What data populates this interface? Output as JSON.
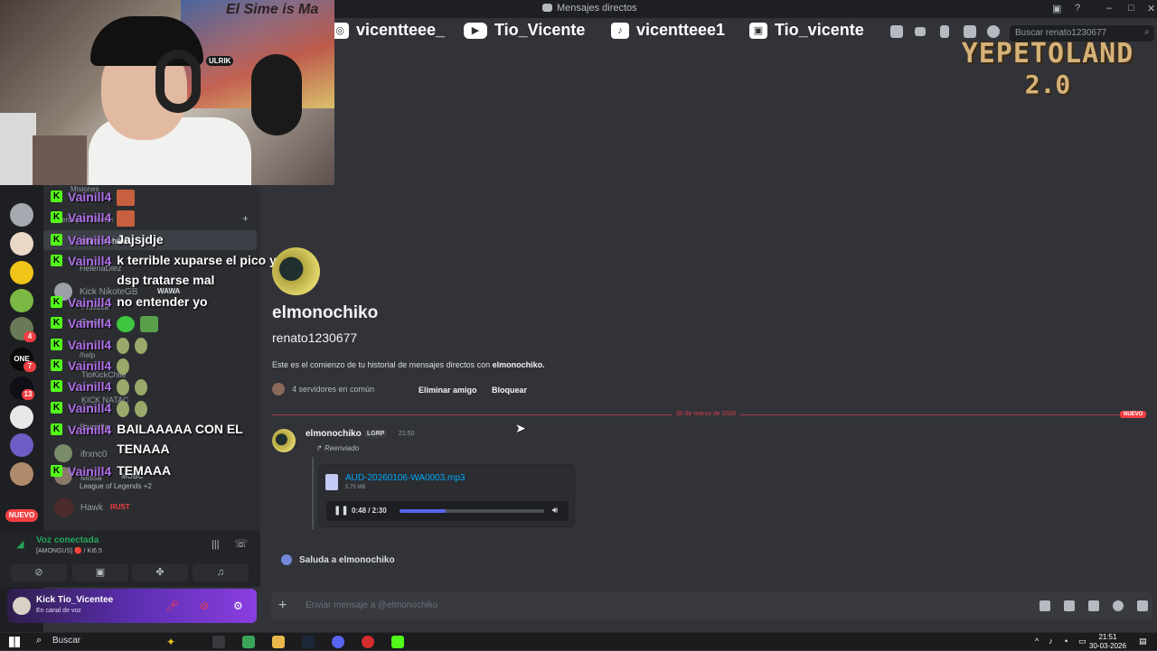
{
  "window": {
    "title": "Mensajes directos"
  },
  "socials": [
    {
      "icon": "instagram-icon",
      "glyph": "◎",
      "handle": "vicentteee_"
    },
    {
      "icon": "youtube-icon",
      "glyph": "▶",
      "handle": "Tio_Vicente"
    },
    {
      "icon": "tiktok-icon",
      "glyph": "♪",
      "handle": "vicentteee1"
    },
    {
      "icon": "twitch-icon",
      "glyph": "▣",
      "handle": "Tio_vicente"
    }
  ],
  "search": {
    "placeholder": "Buscar renato1230677"
  },
  "logo": {
    "line1": "YEPETOLAND",
    "line2": "2.0"
  },
  "webcam": {
    "wall_text": "El Sime is Ma",
    "headphone_brand": "ULRIK"
  },
  "rail": {
    "badges": [
      "4",
      "7",
      "13"
    ],
    "new_label": "NUEVO"
  },
  "sidebar": {
    "items": [
      {
        "name": "Misiones"
      },
      {
        "name": "ensajes directos"
      },
      {
        "name": "elmonochiko"
      },
      {
        "name": "HelenaDiez"
      },
      {
        "name": "Kick NikoteGB",
        "tag": "WAWA"
      },
      {
        "name": "Pruebita"
      },
      {
        "name": "Sheriff"
      },
      {
        "name": "/help"
      },
      {
        "name": "TioKickChile"
      },
      {
        "name": "KICK NATAC"
      },
      {
        "name": "Stuprilla"
      },
      {
        "name": "ifrxnc0"
      },
      {
        "name": "Missa",
        "tag": "MOBC"
      },
      {
        "name": "Hawk",
        "tag": "RUST"
      }
    ],
    "sub_league": "League of Legends +2"
  },
  "chat_overlay": [
    {
      "user": "Vainill4",
      "message": "",
      "emotes": [
        "face-emote"
      ]
    },
    {
      "user": "Vainill4",
      "message": "",
      "emotes": [
        "face-emote"
      ]
    },
    {
      "user": "Vainill4",
      "message": "Jajsjdje",
      "emotes": []
    },
    {
      "user": "Vainill4",
      "message": "k terrible xuparse el pico y dsp tratarse mal",
      "emotes": []
    },
    {
      "user": "Vainill4",
      "message": "no entender yo",
      "emotes": []
    },
    {
      "user": "Vainill4",
      "message": "",
      "emotes": [
        "alien-emote",
        "money-emote"
      ]
    },
    {
      "user": "Vainill4",
      "message": "",
      "emotes": [
        "dance-emote",
        "dance-emote"
      ]
    },
    {
      "user": "Vainill4",
      "message": "",
      "emotes": [
        "dance-emote"
      ]
    },
    {
      "user": "Vainill4",
      "message": "",
      "emotes": [
        "dance-emote",
        "dance-emote"
      ]
    },
    {
      "user": "Vainill4",
      "message": "",
      "emotes": [
        "dance-emote",
        "dance-emote"
      ]
    },
    {
      "user": "Vainill4",
      "message": "BAILAAAAA CON EL TENAAA",
      "emotes": []
    },
    {
      "user": "Vainill4",
      "message": "TEMAAA",
      "emotes": []
    }
  ],
  "voice": {
    "status": "Voz conectada",
    "channel": "[AMONGUS] 🔴 / KI6.5"
  },
  "user_panel": {
    "name": "Kick Tio_Vicentee",
    "status": "En canal de voz"
  },
  "profile": {
    "display_name": "elmonochiko",
    "username": "renato1230677",
    "intro_prefix": "Este es el comienzo de tu historial de mensajes directos con",
    "intro_name": "elmonochiko.",
    "mutual_servers": "4 servidores en común",
    "remove_friend": "Eliminar amigo",
    "block": "Bloquear"
  },
  "divider": {
    "date": "30 de marzo de 2026",
    "new_label": "NUEVO"
  },
  "message": {
    "author": "elmonochiko",
    "tag": "LGRP",
    "time": "21:50",
    "forwarded": "Reenviado",
    "attachment": {
      "filename": "AUD-20260106-WA0003.mp3",
      "size": "5.75 MB",
      "time": "0:48 / 2:30",
      "progress": 0.32
    }
  },
  "wave": {
    "label": "Saluda a elmonochiko"
  },
  "composer": {
    "placeholder": "Enviar mensaje a @elmonochiko"
  },
  "taskbar": {
    "search": "Buscar",
    "time": "21:51",
    "date": "30-03-2026"
  },
  "colors": {
    "accent": "#5865f2",
    "kick_green": "#53fc18",
    "chat_user": "#b06fe8",
    "danger": "#f23f43",
    "voice_green": "#23a55a"
  }
}
